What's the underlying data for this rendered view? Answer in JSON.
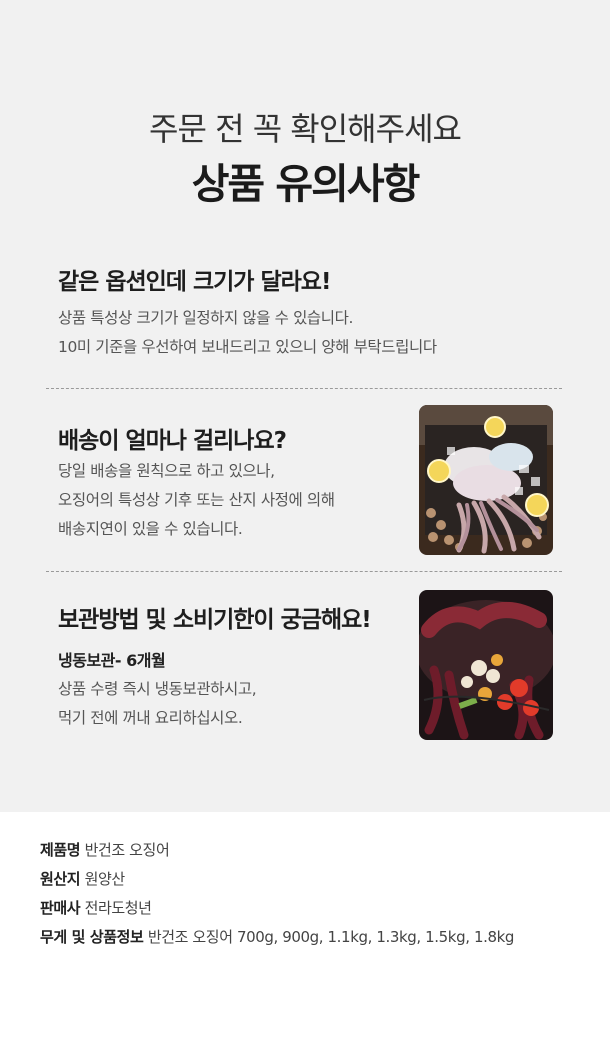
{
  "notice": {
    "subtitle": "주문 전 꼭 확인해주세요",
    "title": "상품 유의사항",
    "sections": [
      {
        "heading": "같은 옵션인데 크기가 달라요!",
        "lines": [
          "상품 특성상 크기가 일정하지 않을 수 있습니다.",
          "10미 기준을 우선하여 보내드리고 있으니 양해 부탁드립니다"
        ]
      },
      {
        "heading": "배송이 얼마나 걸리나요?",
        "lines": [
          "당일 배송을 원칙으로 하고 있으나,",
          "오징어의 특성상 기후 또는 산지 사정에 의해",
          "배송지연이 있을 수 있습니다."
        ],
        "image": "squid-on-ice-photo"
      },
      {
        "heading": "보관방법 및 소비기한이 궁금해요!",
        "sub_label": "냉동보관- 6개월",
        "lines": [
          "상품 수령 즉시 냉동보관하시고,",
          "먹기 전에 꺼내 요리하십시오."
        ],
        "image": "grilled-squid-photo"
      }
    ]
  },
  "product_info": [
    {
      "key": "제품명",
      "value": "반건조 오징어"
    },
    {
      "key": "원산지",
      "value": "원양산"
    },
    {
      "key": "판매사",
      "value": "전라도청년"
    },
    {
      "key": "무게 및 상품정보",
      "value": "반건조 오징어 700g, 900g, 1.1kg, 1.3kg, 1.5kg, 1.8kg"
    }
  ],
  "colors": {
    "notice_bg": "#f1f1f1",
    "page_bg": "#ffffff",
    "divider": "#9a9a9a"
  }
}
